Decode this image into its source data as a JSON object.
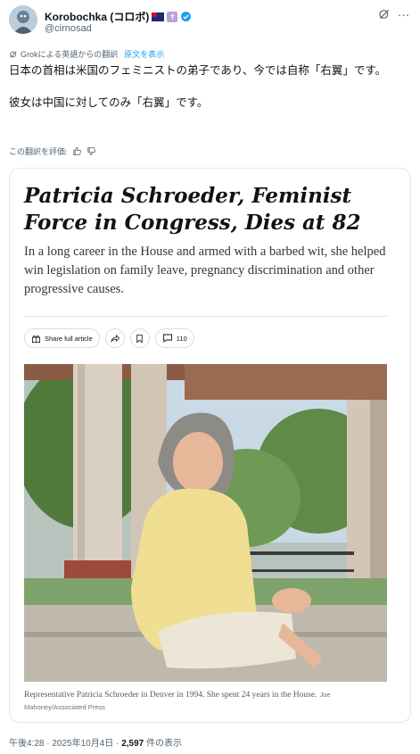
{
  "header": {
    "display_name": "Korobochka (コロボ)",
    "handle": "@cirnosad",
    "flag_icon": "australia-flag-icon",
    "badge_icon": "cross-badge-icon",
    "badge_glyph": "✝",
    "verified_icon": "verified-badge-icon",
    "verified_color": "#1d9bf0"
  },
  "translation": {
    "label": "Grokによる英語からの翻訳",
    "show_original": "原文を表示"
  },
  "tweet": {
    "line1": "日本の首相は米国のフェミニストの弟子であり、今では自称「右翼」です。",
    "line2": "彼女は中国に対してのみ「右翼」です。"
  },
  "rating": {
    "label": "この翻訳を評価:"
  },
  "card": {
    "headline": "Patricia Schroeder, Feminist Force in Congress, Dies at 82",
    "summary": "In a long career in the House and armed with a barbed wit, she helped win legislation on family leave, pregnancy discrimination and other progressive causes.",
    "share_label": "Share full article",
    "comment_count": "110",
    "caption": "Representative Patricia Schroeder in Denver in 1994. She spent 24 years in the House.",
    "credit": "Joe Mahoney/Associated Press"
  },
  "meta": {
    "time": "午後4:28",
    "separator": "·",
    "date": "2025年10月4日",
    "views": "2,597",
    "views_suffix": "件の表示"
  }
}
